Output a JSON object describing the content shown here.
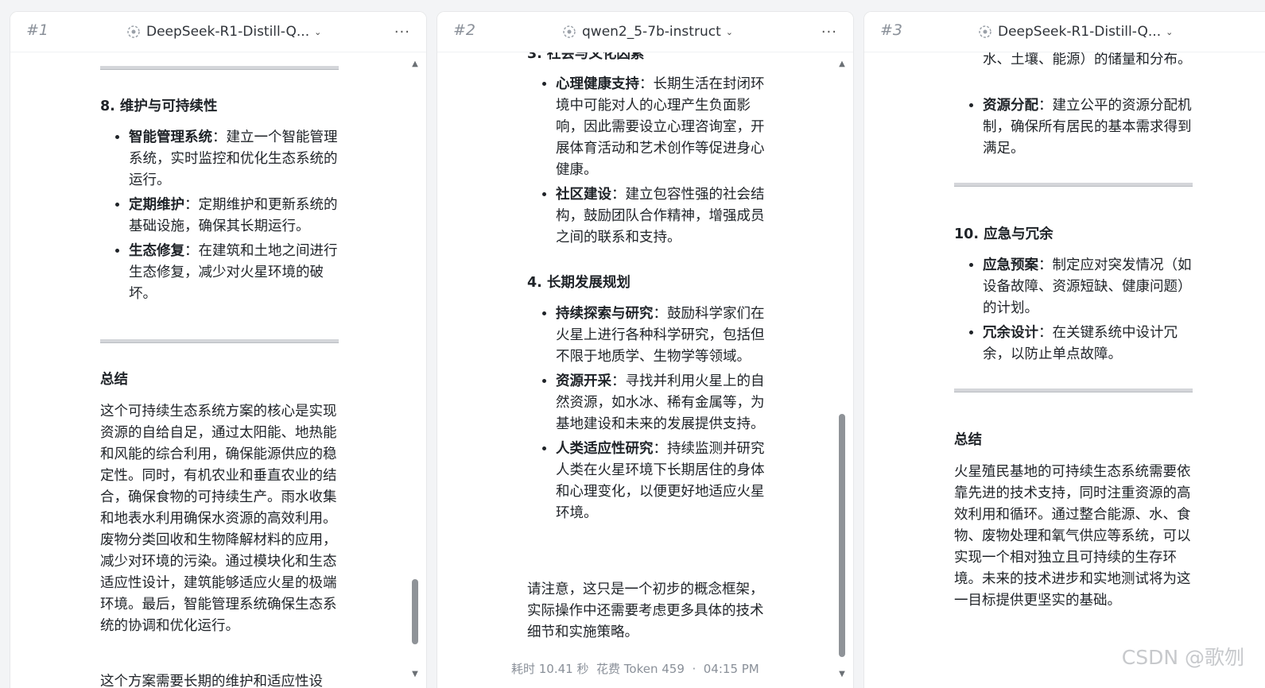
{
  "panels": [
    {
      "number": "#1",
      "model": "DeepSeek-R1-Distill-Q...",
      "sections": {
        "s8_title": "8. 维护与可持续性",
        "s8_items": [
          {
            "label": "智能管理系统",
            "text": "：建立一个智能管理系统，实时监控和优化生态系统的运行。"
          },
          {
            "label": "定期维护",
            "text": "：定期维护和更新系统的基础设施，确保其长期运行。"
          },
          {
            "label": "生态修复",
            "text": "：在建筑和土地之间进行生态修复，减少对火星环境的破坏。"
          }
        ],
        "summary_title": "总结",
        "summary_text": "这个可持续生态系统方案的核心是实现资源的自给自足，通过太阳能、地热能和风能的综合利用，确保能源供应的稳定性。同时，有机农业和垂直农业的结合，确保食物的可持续生产。雨水收集和地表水利用确保水资源的高效利用。废物分类回收和生物降解材料的应用，减少对环境的污染。通过模块化和生态适应性设计，建筑能够适应火星的极端环境。最后，智能管理系统确保生态系统的协调和优化运行。",
        "cut_text": "这个方案需要长期的维护和适应性设"
      }
    },
    {
      "number": "#2",
      "model": "qwen2_5-7b-instruct",
      "sections": {
        "s3_title": "3. 社会与文化因素",
        "s3_items": [
          {
            "label": "心理健康支持",
            "text": "：长期生活在封闭环境中可能对人的心理产生负面影响，因此需要设立心理咨询室，开展体育活动和艺术创作等促进身心健康。"
          },
          {
            "label": "社区建设",
            "text": "：建立包容性强的社会结构，鼓励团队合作精神，增强成员之间的联系和支持。"
          }
        ],
        "s4_title": "4. 长期发展规划",
        "s4_items": [
          {
            "label": "持续探索与研究",
            "text": "：鼓励科学家们在火星上进行各种科学研究，包括但不限于地质学、生物学等领域。"
          },
          {
            "label": "资源开采",
            "text": "：寻找并利用火星上的自然资源，如水冰、稀有金属等，为基地建设和未来的发展提供支持。"
          },
          {
            "label": "人类适应性研究",
            "text": "：持续监测并研究人类在火星环境下长期居住的身体和心理变化，以便更好地适应火星环境。"
          }
        ],
        "note": "请注意，这只是一个初步的概念框架，实际操作中还需要考虑更多具体的技术细节和实施策略。"
      },
      "footer": {
        "time_label": "耗时 10.41 秒",
        "token_label": "花费 Token 459",
        "sep": "·",
        "clock": "04:15 PM"
      }
    },
    {
      "number": "#3",
      "model": "DeepSeek-R1-Distill-Q...",
      "sections": {
        "top_text": "水、土壤、能源）的储量和分布。",
        "top_items": [
          {
            "label": "资源分配",
            "text": "：建立公平的资源分配机制，确保所有居民的基本需求得到满足。"
          }
        ],
        "s10_title": "10. 应急与冗余",
        "s10_items": [
          {
            "label": "应急预案",
            "text": "：制定应对突发情况（如设备故障、资源短缺、健康问题）的计划。"
          },
          {
            "label": "冗余设计",
            "text": "：在关键系统中设计冗余，以防止单点故障。"
          }
        ],
        "summary_title": "总结",
        "summary_text": "火星殖民基地的可持续生态系统需要依靠先进的技术支持，同时注重资源的高效利用和循环。通过整合能源、水、食物、废物处理和氧气供应等系统，可以实现一个相对独立且可持续的生存环境。未来的技术进步和实地测试将为这一目标提供更坚实的基础。"
      }
    }
  ],
  "watermark": "CSDN @歌刎",
  "icons": {
    "model": "model-logo-icon",
    "more": "more-options-icon",
    "chevron": "chevron-down-icon"
  }
}
